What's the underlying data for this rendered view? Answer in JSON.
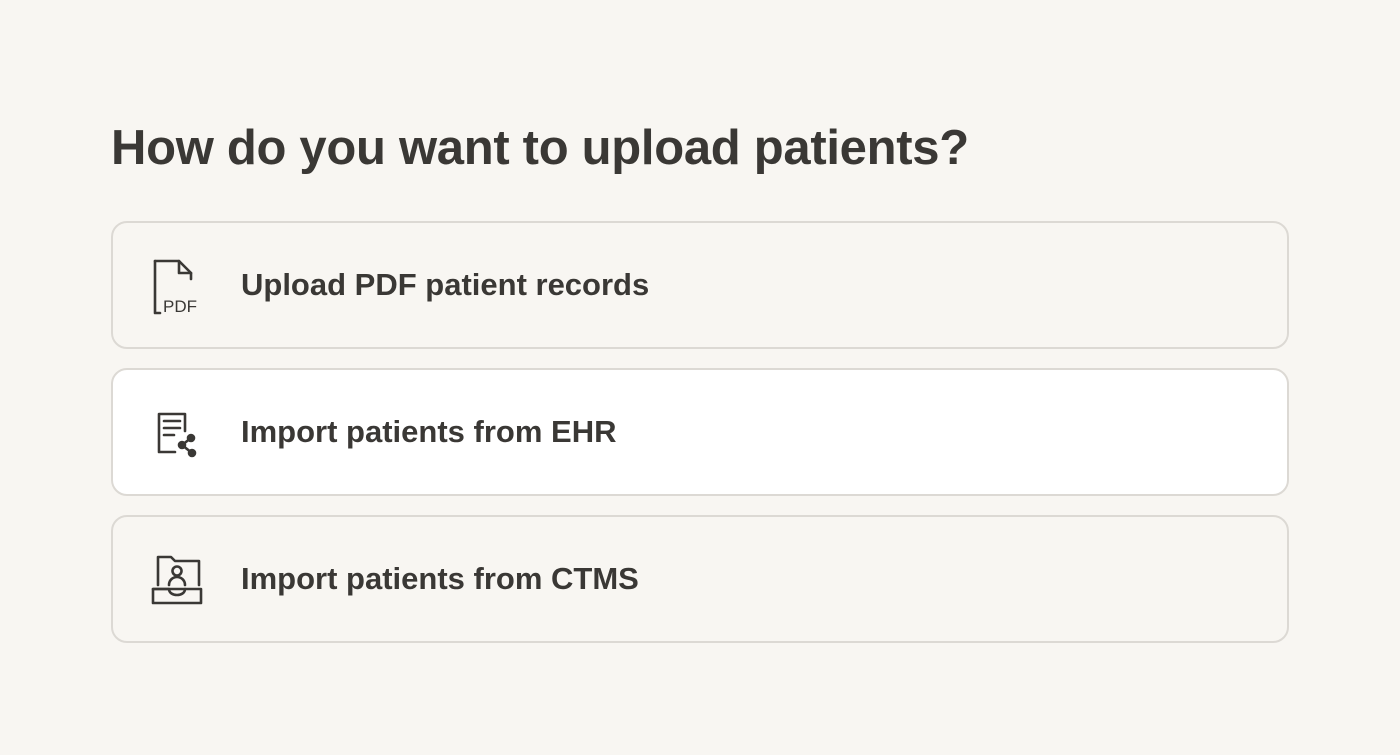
{
  "page": {
    "title": "How do you want to upload patients?"
  },
  "options": [
    {
      "label": "Upload PDF patient records",
      "icon": "pdf-file-icon",
      "icon_text": "PDF",
      "selected": false
    },
    {
      "label": "Import patients from EHR",
      "icon": "ehr-share-icon",
      "selected": true
    },
    {
      "label": "Import patients from CTMS",
      "icon": "patient-folder-icon",
      "selected": false
    }
  ],
  "colors": {
    "background": "#f8f6f2",
    "card_border": "#dcd9d4",
    "selected_card": "#ffffff",
    "text": "#3a3835"
  }
}
